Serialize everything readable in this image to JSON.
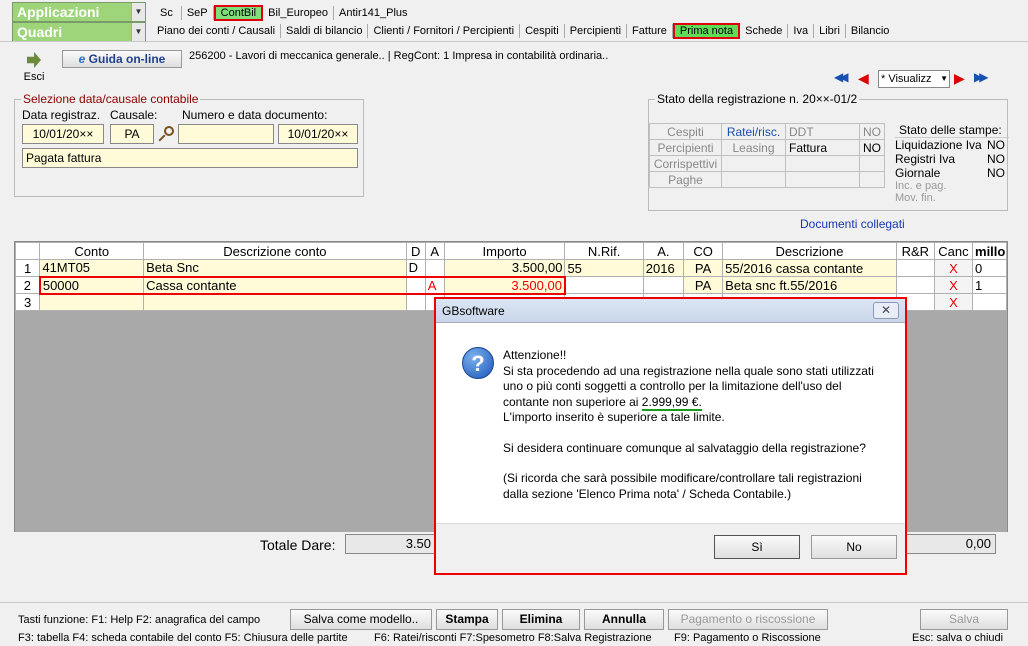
{
  "topbar": {
    "applicazioni": "Applicazioni",
    "quadri": "Quadri",
    "menu1": [
      "Sc",
      "SeP",
      "ContBil",
      "Bil_Europeo",
      "Antir141_Plus"
    ],
    "menu2": [
      "Piano dei conti / Causali",
      "Saldi di bilancio",
      "Clienti / Fornitori / Percipienti",
      "Cespiti",
      "Percipienti",
      "Fatture",
      "Prima nota",
      "Schede",
      "Iva",
      "Libri",
      "Bilancio"
    ]
  },
  "toolbar": {
    "esci": "Esci",
    "guida": "Guida on-line",
    "info": "256200 - Lavori di meccanica generale.. | RegCont: 1 Impresa  in contabilità ordinaria..",
    "visualizza": "* Visualizz"
  },
  "selezione": {
    "title": "Selezione data/causale contabile",
    "data_label": "Data registraz.",
    "causale_label": "Causale:",
    "numero_label": "Numero e data documento:",
    "data_value": "10/01/20××",
    "causale_value": "PA",
    "numero_value": "",
    "data_doc_value": "10/01/20××",
    "desc_value": "Pagata fattura"
  },
  "stato": {
    "title": "Stato della registrazione n. 20××-01/2",
    "rows": [
      [
        "Cespiti",
        "Ratei/risc.",
        "DDT",
        "NO"
      ],
      [
        "Percipienti",
        "Leasing",
        "Fattura",
        "NO"
      ],
      [
        "Corrispettivi",
        "",
        "",
        ""
      ],
      [
        "Paghe",
        "",
        "",
        ""
      ]
    ],
    "stampe_title": "Stato delle stampe:",
    "stampe": [
      [
        "Liquidazione Iva",
        "NO"
      ],
      [
        "Registri Iva",
        "NO"
      ],
      [
        "Giornale",
        "NO"
      ],
      [
        "Inc. e pag.",
        ""
      ],
      [
        "Mov. fin.",
        ""
      ]
    ]
  },
  "doc_collegati": "Documenti collegati",
  "grid": {
    "headers": [
      "",
      "Conto",
      "Descrizione conto",
      "D",
      "A",
      "Importo",
      "N.Rif.",
      "A.",
      "CO",
      "Descrizione",
      "R&R",
      "Canc",
      "millo"
    ],
    "rows": [
      [
        "1",
        "41MT05",
        "Beta Snc",
        "D",
        "",
        "3.500,00",
        "55",
        "2016",
        "PA",
        "55/2016 cassa contante",
        "",
        "X",
        "0"
      ],
      [
        "2",
        "50000",
        "Cassa contante",
        "",
        "A",
        "3.500,00",
        "",
        "",
        "PA",
        "Beta snc ft.55/2016",
        "",
        "X",
        "1"
      ],
      [
        "3",
        "",
        "",
        "",
        "",
        "",
        "",
        "",
        "",
        "",
        "",
        "X",
        ""
      ]
    ]
  },
  "totals": {
    "dare_label": "Totale Dare:",
    "dare_value": "3.50",
    "right_value": "0,00"
  },
  "dialog": {
    "title": "GBsoftware",
    "l1": "Attenzione!!",
    "l2": "Si sta procedendo ad una registrazione nella quale sono stati utilizzati",
    "l3": "uno o più conti soggetti a controllo per la limitazione dell'uso del",
    "l4a": "contante non superiore ai ",
    "l4b": "2.999,99 €.",
    "l5": "L'importo inserito è superiore a tale limite.",
    "l6": "Si desidera continuare comunque al salvataggio della registrazione?",
    "l7": "(Si ricorda che sarà possibile modificare/controllare tali registrazioni",
    "l8": "dalla sezione 'Elenco Prima nota' / Scheda Contabile.)",
    "si": "Sì",
    "no": "No"
  },
  "bottom": {
    "tasti": "Tasti funzione: F1: Help  F2: anagrafica del campo",
    "salva_modello": "Salva come modello..",
    "stampa": "Stampa",
    "elimina": "Elimina",
    "annulla": "Annulla",
    "pagamento": "Pagamento o riscossione",
    "salva": "Salva",
    "f3": "F3: tabella   F4: scheda contabile del conto  F5: Chiusura delle partite",
    "f6": "F6: Ratei/risconti  F7:Spesometro  F8:Salva Registrazione",
    "f9": "F9: Pagamento o Riscossione",
    "esc": "Esc: salva o chiudi"
  }
}
